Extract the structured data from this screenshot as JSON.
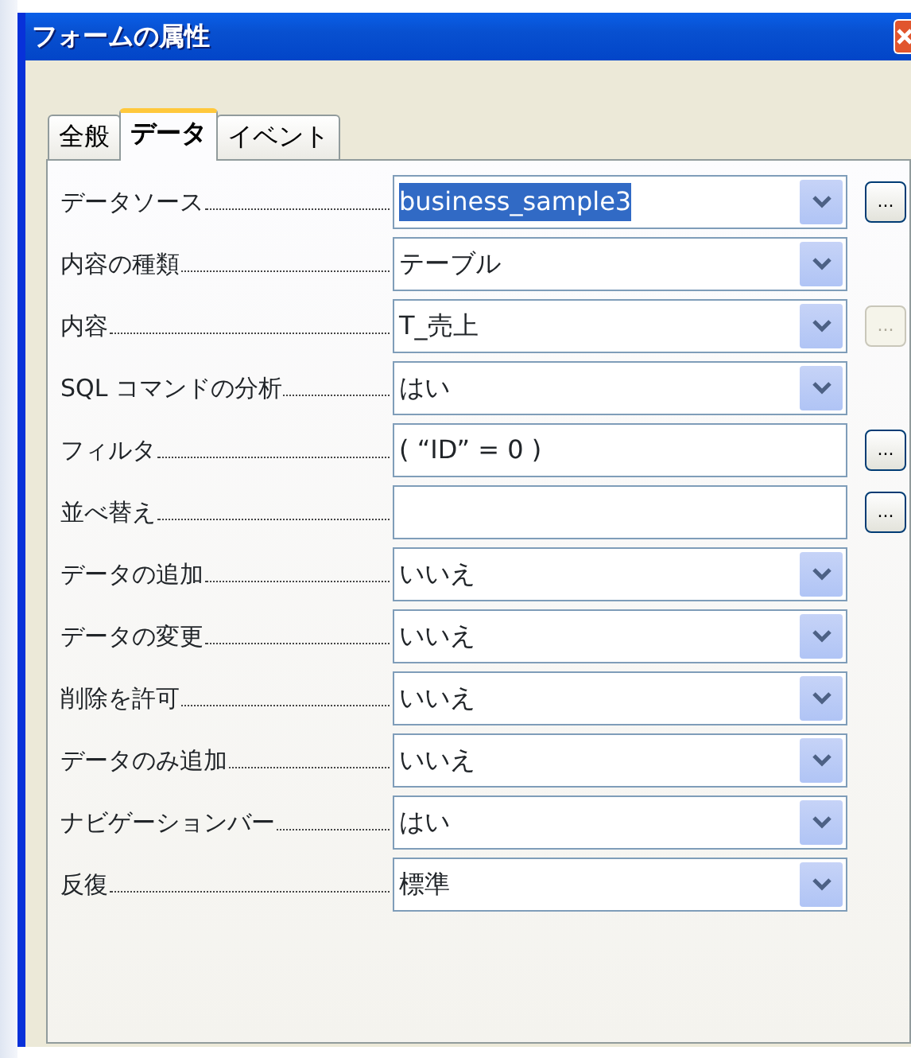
{
  "window": {
    "title": "フォームの属性"
  },
  "tabs": [
    {
      "label": "全般",
      "selected": false
    },
    {
      "label": "データ",
      "selected": true
    },
    {
      "label": "イベント",
      "selected": false
    }
  ],
  "properties": [
    {
      "label": "データソース",
      "kind": "combo",
      "value": "business_sample3",
      "value_selected": true,
      "button": {
        "label": "...",
        "disabled": false
      }
    },
    {
      "label": "内容の種類",
      "kind": "combo",
      "value": "テーブル",
      "value_selected": false
    },
    {
      "label": "内容",
      "kind": "combo",
      "value": "T_売上",
      "value_selected": false,
      "button": {
        "label": "...",
        "disabled": true
      }
    },
    {
      "label": "SQL コマンドの分析",
      "kind": "combo",
      "value": "はい",
      "value_selected": false
    },
    {
      "label": "フィルタ",
      "kind": "text",
      "value": "( “ID” = 0 )",
      "value_selected": false,
      "button": {
        "label": "...",
        "disabled": false
      }
    },
    {
      "label": "並べ替え",
      "kind": "text",
      "button": {
        "label": "...",
        "disabled": false
      }
    },
    {
      "label": "データの追加",
      "kind": "combo",
      "value": "いいえ",
      "value_selected": false
    },
    {
      "label": "データの変更",
      "kind": "combo",
      "value": "いいえ",
      "value_selected": false
    },
    {
      "label": "削除を許可",
      "kind": "combo",
      "value": "いいえ",
      "value_selected": false
    },
    {
      "label": "データのみ追加",
      "kind": "combo",
      "value": "いいえ",
      "value_selected": false
    },
    {
      "label": "ナビゲーションバー",
      "kind": "combo",
      "value": "はい",
      "value_selected": false
    },
    {
      "label": "反復",
      "kind": "combo",
      "value": "標準",
      "value_selected": false
    }
  ]
}
